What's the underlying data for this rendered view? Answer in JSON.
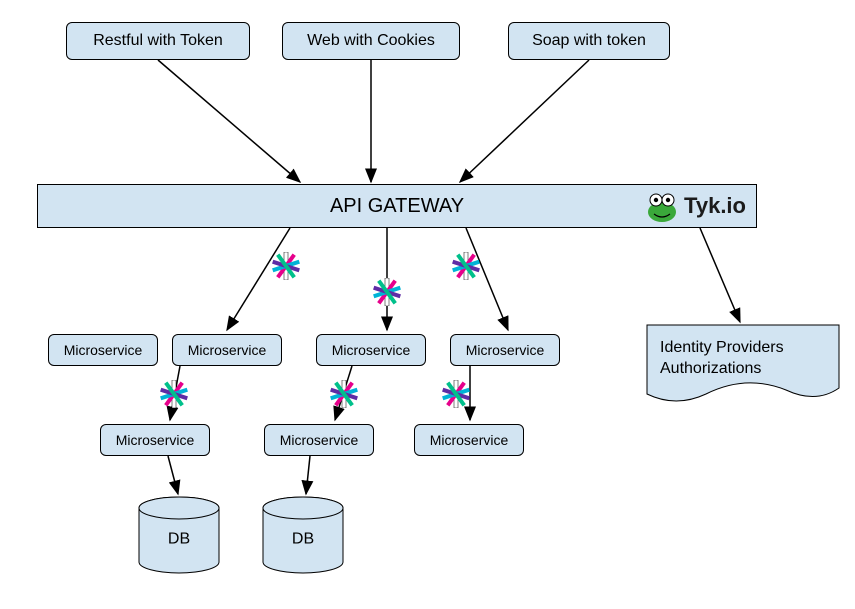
{
  "clients": {
    "restful": "Restful with Token",
    "web": "Web with Cookies",
    "soap": "Soap with token"
  },
  "gateway": {
    "label": "API GATEWAY",
    "logo_text": "Tyk.io"
  },
  "microservices": {
    "row1": {
      "ms1": "Microservice",
      "ms2": "Microservice",
      "ms3": "Microservice",
      "ms4": "Microservice"
    },
    "row2": {
      "ms5": "Microservice",
      "ms6": "Microservice",
      "ms7": "Microservice"
    }
  },
  "db": {
    "db1": "DB",
    "db2": "DB"
  },
  "identity": {
    "line1": "Identity Providers",
    "line2": "Authorizations"
  },
  "icons": {
    "jwt": "jwt-icon",
    "tyk": "tyk-logo-icon"
  }
}
